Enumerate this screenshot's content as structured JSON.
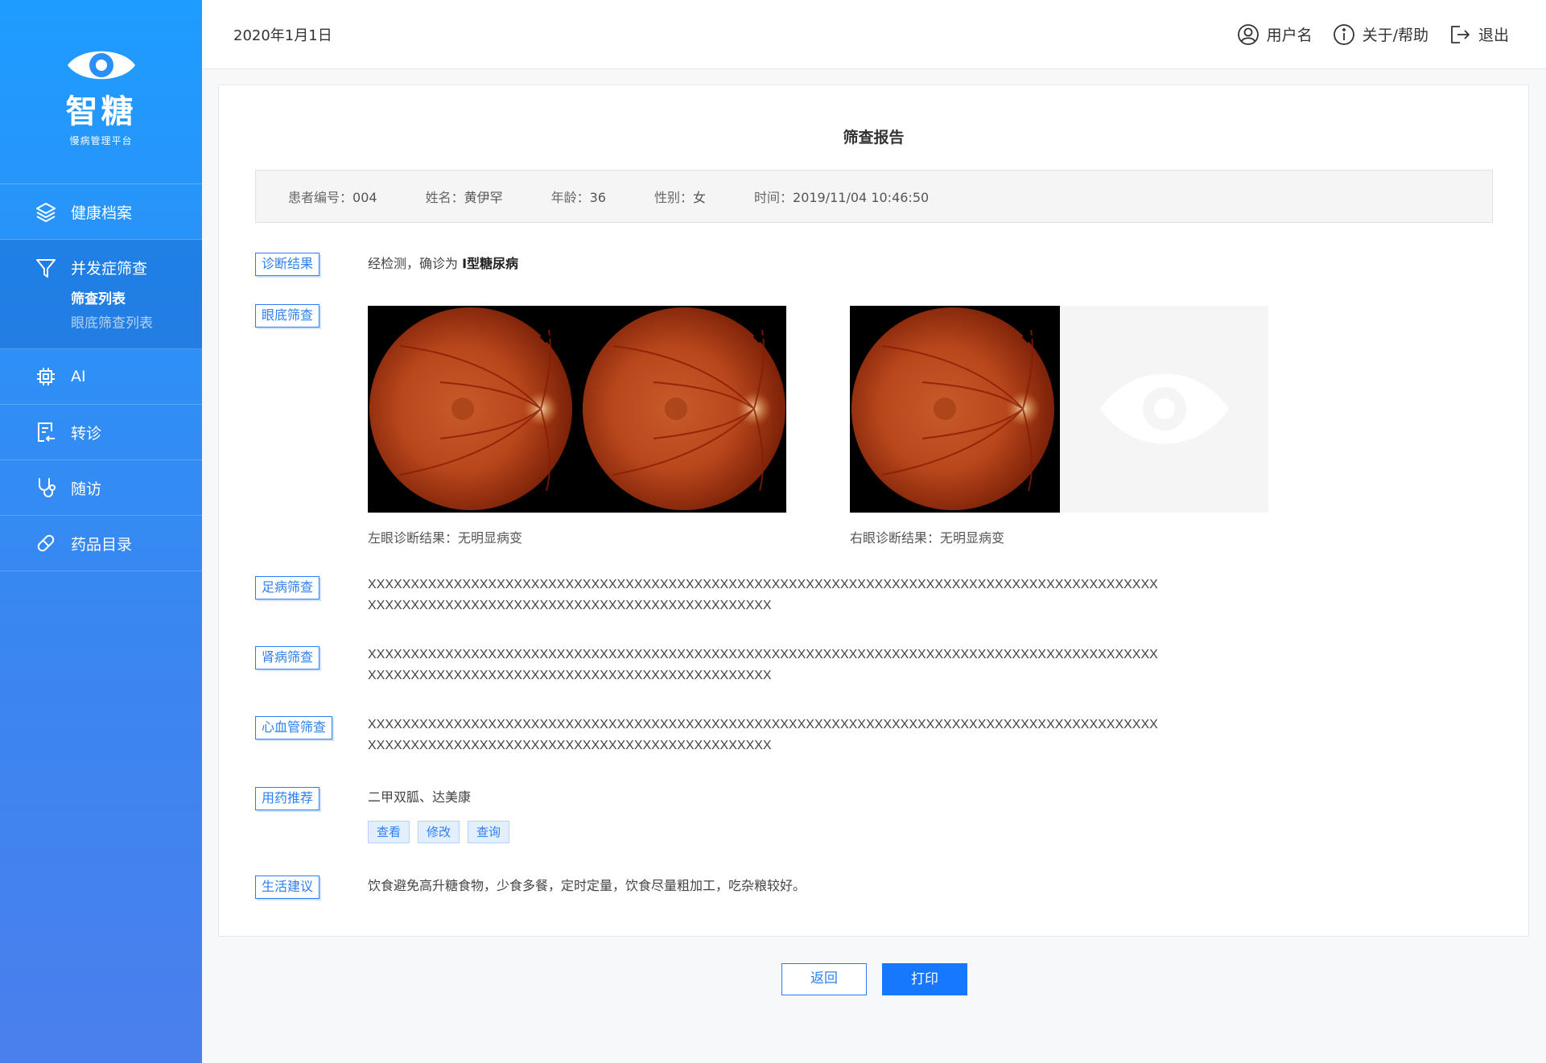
{
  "brand": {
    "name": "智糖",
    "subtitle": "慢病管理平台"
  },
  "sidebar": {
    "items": [
      {
        "label": "健康档案",
        "icon": "layers-icon"
      },
      {
        "label": "并发症筛查",
        "icon": "filter-icon",
        "active": true,
        "children": [
          {
            "label": "筛查列表",
            "current": true
          },
          {
            "label": "眼底筛查列表"
          }
        ]
      },
      {
        "label": "AI",
        "icon": "chip-icon"
      },
      {
        "label": "转诊",
        "icon": "referral-icon"
      },
      {
        "label": "随访",
        "icon": "stethoscope-icon"
      },
      {
        "label": "药品目录",
        "icon": "pill-icon"
      }
    ]
  },
  "header": {
    "date": "2020年1月1日",
    "user_label": "用户名",
    "help_label": "关于/帮助",
    "logout_label": "退出"
  },
  "report": {
    "title": "筛查报告",
    "patient": {
      "id_key": "患者编号：",
      "id": "004",
      "name_key": "姓名：",
      "name": "黄伊罕",
      "age_key": "年龄：",
      "age": "36",
      "sex_key": "性别：",
      "sex": "女",
      "time_key": "时间：",
      "time": "2019/11/04  10:46:50"
    },
    "diagnosis": {
      "tag": "诊断结果",
      "prefix": "经检测，确诊为 ",
      "result": "I型糖尿病"
    },
    "eye": {
      "tag": "眼底筛查",
      "left_caption": "左眼诊断结果：无明显病变",
      "right_caption": "右眼诊断结果：无明显病变"
    },
    "foot": {
      "tag": "足病筛查",
      "line1": "XXXXXXXXXXXXXXXXXXXXXXXXXXXXXXXXXXXXXXXXXXXXXXXXXXXXXXXXXXXXXXXXXXXXXXXXXXXXXXXXXXXXXXXXXXXX",
      "line2": "XXXXXXXXXXXXXXXXXXXXXXXXXXXXXXXXXXXXXXXXXXXXXXX"
    },
    "kidney": {
      "tag": "肾病筛查",
      "line1": "XXXXXXXXXXXXXXXXXXXXXXXXXXXXXXXXXXXXXXXXXXXXXXXXXXXXXXXXXXXXXXXXXXXXXXXXXXXXXXXXXXXXXXXXXXXX",
      "line2": "XXXXXXXXXXXXXXXXXXXXXXXXXXXXXXXXXXXXXXXXXXXXXXX"
    },
    "cardio": {
      "tag": "心血管筛查",
      "line1": "XXXXXXXXXXXXXXXXXXXXXXXXXXXXXXXXXXXXXXXXXXXXXXXXXXXXXXXXXXXXXXXXXXXXXXXXXXXXXXXXXXXXXXXXXXXX",
      "line2": "XXXXXXXXXXXXXXXXXXXXXXXXXXXXXXXXXXXXXXXXXXXXXXX"
    },
    "medicine": {
      "tag": "用药推荐",
      "text": "二甲双胍、达美康",
      "buttons": [
        "查看",
        "修改",
        "查询"
      ]
    },
    "lifestyle": {
      "tag": "生活建议",
      "text": "饮食避免高升糖食物，少食多餐，定时定量，饮食尽量粗加工，吃杂粮较好。"
    }
  },
  "actions": {
    "back": "返回",
    "print": "打印"
  },
  "colors": {
    "primary": "#1677ff",
    "sidebar_top": "#1e9cff",
    "tag_border": "#2d7ff0"
  }
}
